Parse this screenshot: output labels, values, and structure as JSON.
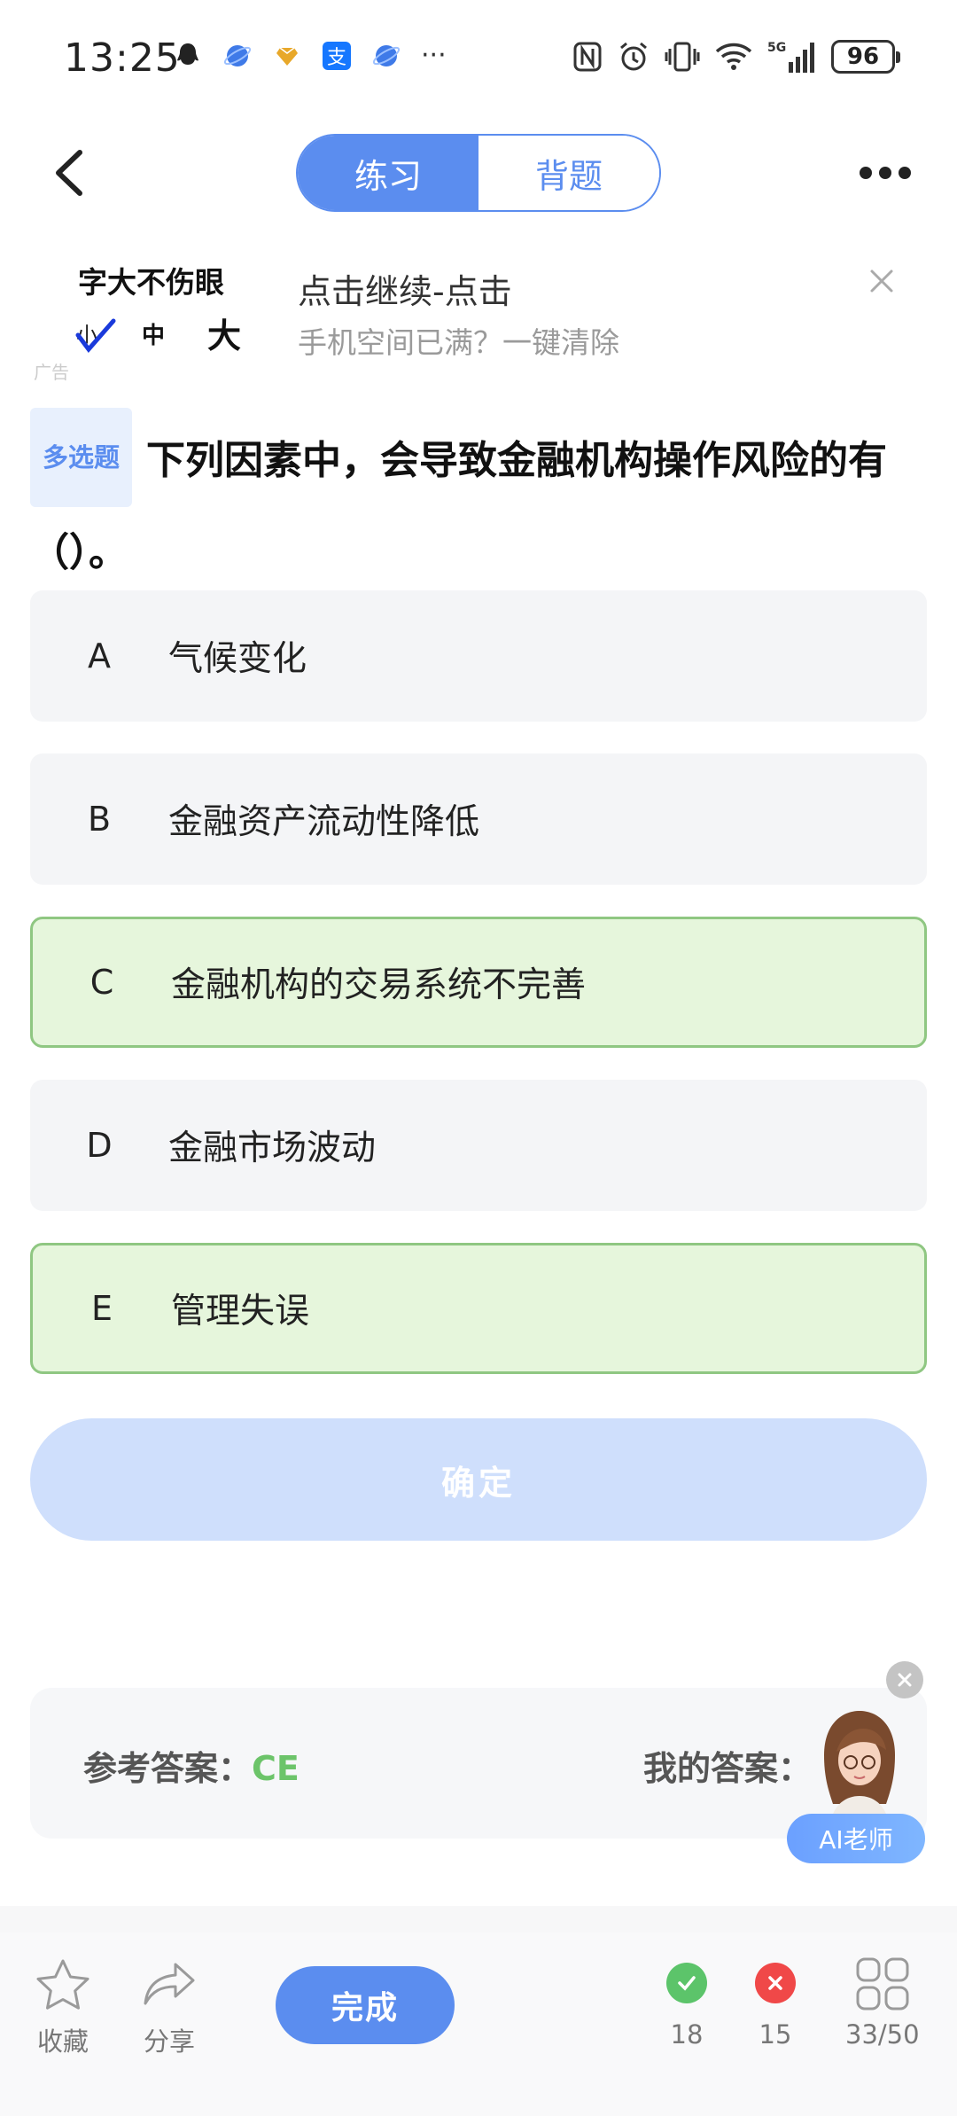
{
  "status_bar": {
    "time": "13:25",
    "battery": "96",
    "left_icons": [
      "qq-icon",
      "browser-icon",
      "honor-icon",
      "alipay-icon",
      "browser-icon"
    ],
    "right_icons": [
      "nfc-icon",
      "alarm-icon",
      "vibrate-icon",
      "wifi-icon",
      "signal-5g-icon",
      "battery-icon"
    ],
    "more": "···"
  },
  "header": {
    "tabs": [
      {
        "label": "练习",
        "active": true
      },
      {
        "label": "背题",
        "active": false
      }
    ]
  },
  "ad": {
    "brand_title": "字大不伤眼",
    "size_small": "小",
    "size_mid": "中",
    "size_big": "大",
    "tag": "广告",
    "title": "点击继续-点击",
    "subtitle": "手机空间已满？一键清除"
  },
  "question": {
    "type_badge": "多选题",
    "text": "下列因素中，会导致金融机构操作风险的有（）。"
  },
  "options": [
    {
      "letter": "A",
      "text": "气候变化",
      "selected": false
    },
    {
      "letter": "B",
      "text": "金融资产流动性降低",
      "selected": false
    },
    {
      "letter": "C",
      "text": "金融机构的交易系统不完善",
      "selected": true
    },
    {
      "letter": "D",
      "text": "金融市场波动",
      "selected": false
    },
    {
      "letter": "E",
      "text": "管理失误",
      "selected": true
    }
  ],
  "confirm_label": "确定",
  "answer": {
    "ref_label": "参考答案：",
    "ref_value": "CE",
    "my_label": "我的答案：",
    "ai_label": "AI老师"
  },
  "bottom": {
    "favorite": "收藏",
    "share": "分享",
    "done": "完成",
    "correct_count": "18",
    "wrong_count": "15",
    "progress": "33/50"
  },
  "colors": {
    "accent": "#5b8def",
    "selected_bg": "#e6f6dc",
    "selected_border": "#8fc782",
    "correct": "#5cc46a",
    "wrong": "#f04848"
  }
}
